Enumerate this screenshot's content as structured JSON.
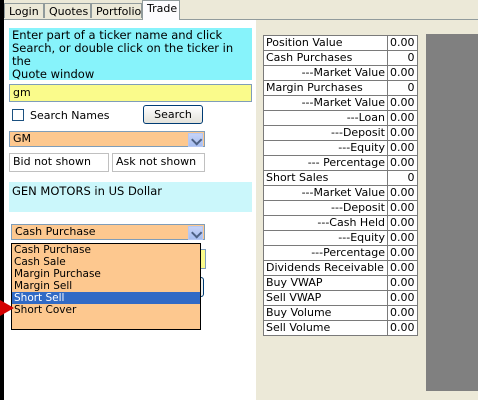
{
  "tabs": [
    "Login",
    "Quotes",
    "Portfolio",
    "Trade"
  ],
  "active_tab": "Trade",
  "instructions": [
    "Enter part of a ticker name and click",
    "Search, or double click on the ticker in the",
    "Quote window"
  ],
  "ticker_input": {
    "value": "gm"
  },
  "search_names_label": "Search Names",
  "search_button": "Search",
  "ticker_select": {
    "value": "GM"
  },
  "bid_text": "Bid not shown",
  "ask_text": "Ask not shown",
  "description": "GEN MOTORS in US Dollar",
  "trade_type_select": {
    "value": "Cash Purchase"
  },
  "trade_type_options": [
    "Cash Purchase",
    "Cash Sale",
    "Margin Purchase",
    "Margin Sell",
    "Short Sell",
    "Short Cover"
  ],
  "selected_option": "Short Sell",
  "colors": {
    "info_bg": "#87f3fb",
    "input_yellow": "#fafb8b",
    "select_orange": "#fdc88f",
    "highlight": "#316ac5",
    "arrow": "#d40000",
    "grey": "#808080"
  },
  "positions": [
    {
      "label": "Position Value",
      "value": "0.00"
    },
    {
      "label": "Cash Purchases",
      "value": "0"
    },
    {
      "label": "---Market Value",
      "value": "0.00"
    },
    {
      "label": "Margin Purchases",
      "value": "0"
    },
    {
      "label": "---Market Value",
      "value": "0.00"
    },
    {
      "label": "---Loan",
      "value": "0.00"
    },
    {
      "label": "---Deposit",
      "value": "0.00"
    },
    {
      "label": "---Equity",
      "value": "0.00"
    },
    {
      "label": "--- Percentage",
      "value": "0.00"
    },
    {
      "label": "Short Sales",
      "value": "0"
    },
    {
      "label": "---Market Value",
      "value": "0.00"
    },
    {
      "label": "---Deposit",
      "value": "0.00"
    },
    {
      "label": "---Cash Held",
      "value": "0.00"
    },
    {
      "label": "---Equity",
      "value": "0.00"
    },
    {
      "label": "---Percentage",
      "value": "0.00"
    },
    {
      "label": "Dividends Receivable",
      "value": "0.00"
    },
    {
      "label": "Buy VWAP",
      "value": "0.00"
    },
    {
      "label": "Sell VWAP",
      "value": "0.00"
    },
    {
      "label": "Buy Volume",
      "value": "0.00"
    },
    {
      "label": "Sell Volume",
      "value": "0.00"
    }
  ],
  "right_aligned_rows": [
    2,
    4,
    5,
    6,
    7,
    8,
    10,
    11,
    12,
    13,
    14
  ]
}
